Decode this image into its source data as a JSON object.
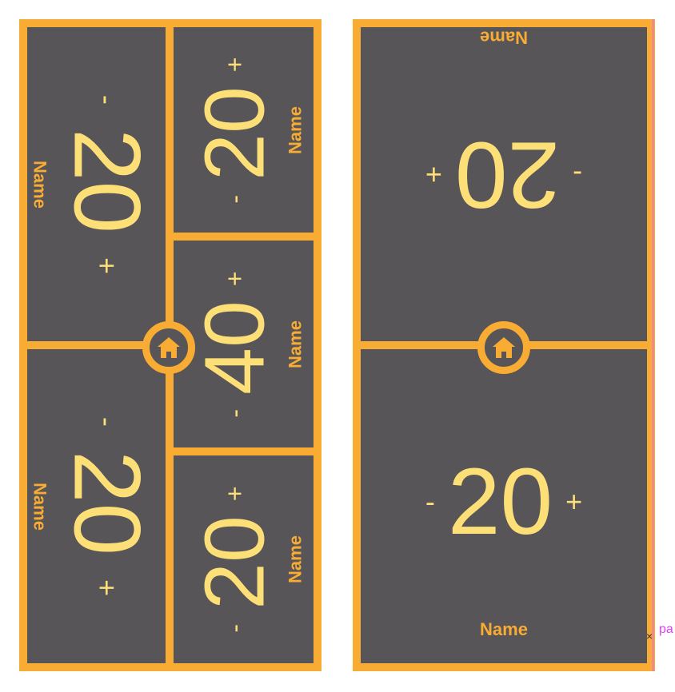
{
  "board_left": {
    "players": [
      {
        "name": "Name",
        "life": "20",
        "minus": "-",
        "plus": "+"
      },
      {
        "name": "Name",
        "life": "20",
        "minus": "-",
        "plus": "+"
      },
      {
        "name": "Name",
        "life": "40",
        "minus": "-",
        "plus": "+"
      },
      {
        "name": "Name",
        "life": "20",
        "minus": "-",
        "plus": "+"
      },
      {
        "name": "Name",
        "life": "20",
        "minus": "-",
        "plus": "+"
      }
    ]
  },
  "board_right": {
    "players": [
      {
        "name": "Name",
        "life": "20",
        "minus": "-",
        "plus": "+"
      },
      {
        "name": "Name",
        "life": "20",
        "minus": "-",
        "plus": "+"
      }
    ]
  },
  "stray": {
    "close": "×",
    "text": "pa"
  },
  "colors": {
    "accent": "#f8ac33",
    "panel": "#575557",
    "number": "#fddf77"
  },
  "icons": {
    "home": "home-icon"
  }
}
